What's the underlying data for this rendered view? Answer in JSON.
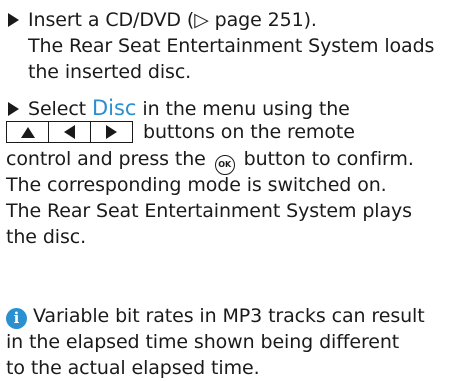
{
  "step1": {
    "line1": "Insert a CD/DVD (▷ page 251).",
    "line2": "The Rear Seat Entertainment System loads",
    "line3": "the inserted disc."
  },
  "step2": {
    "select_prefix": "Select ",
    "menu_item": "Disc",
    "select_suffix": " in the menu using the",
    "buttons_suffix": "buttons on the remote",
    "control_prefix": "control and press the ",
    "ok_symbol": "OK",
    "control_suffix": " button to confirm.",
    "line4": "The corresponding mode is switched on.",
    "line5": "The Rear Seat Entertainment System plays",
    "line6": "the disc."
  },
  "note": {
    "icon": "info-icon",
    "line1": "Variable bit rates in MP3 tracks can result",
    "line2": "in the elapsed time shown being different",
    "line3": "to the actual elapsed time."
  },
  "colors": {
    "accent": "#2b8fd0",
    "text": "#1a1a1a"
  }
}
